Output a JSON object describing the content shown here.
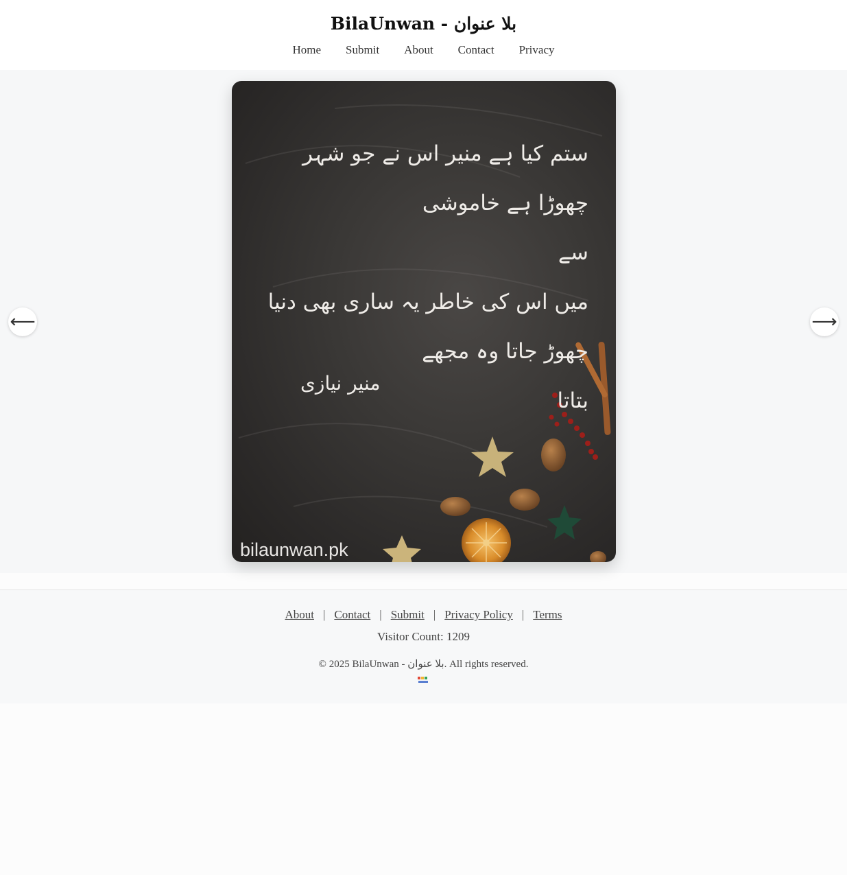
{
  "header": {
    "title": "BilaUnwan - بلا عنوان",
    "nav": [
      "Home",
      "Submit",
      "About",
      "Contact",
      "Privacy"
    ]
  },
  "carousel": {
    "prev_icon": "arrow-left-icon",
    "next_icon": "arrow-right-icon",
    "prev_glyph": "⟵",
    "next_glyph": "⟶",
    "poem_lines": [
      "ستم کیا ہے منیر اس نے جو شہر چھوڑا ہے خاموشی",
      "سے",
      "میں اس کی خاطر یہ ساری بھی دنیا چھوڑ جاتا وہ مجھے",
      "بتاتا"
    ],
    "poet": "منیر نیازی",
    "watermark": "bilaunwan.pk"
  },
  "footer": {
    "links": [
      "About",
      "Contact",
      "Submit",
      "Privacy Policy",
      "Terms"
    ],
    "separator": "|",
    "visitor_count": "Visitor Count: 1209",
    "copyright": "© 2025 BilaUnwan - بلا عنوان. All rights reserved."
  },
  "colors": {
    "header_bg": "#ffffff",
    "main_bg": "#f6f7f8",
    "poster_bg": "#3a3836",
    "poem_text": "#efece8"
  }
}
